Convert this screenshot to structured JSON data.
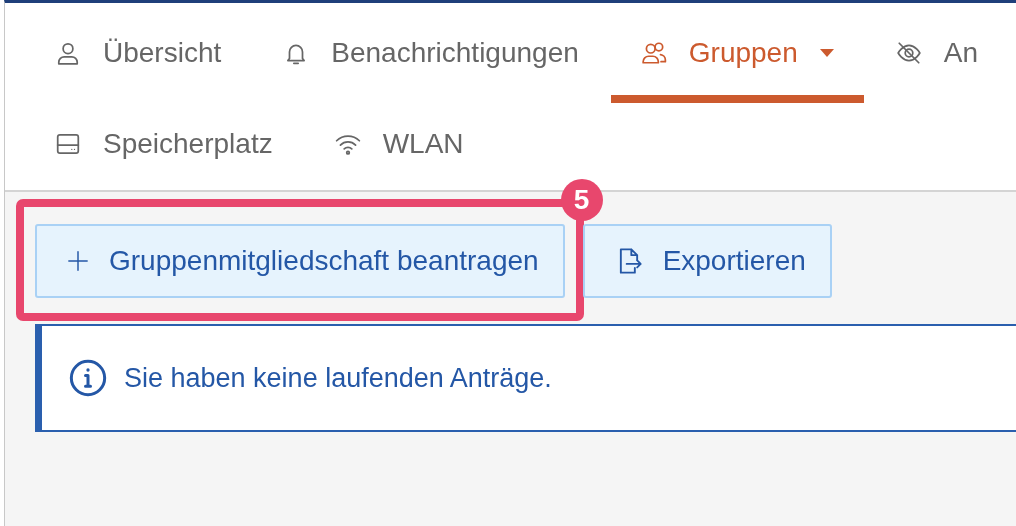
{
  "nav": {
    "rows": [
      [
        {
          "label": "Übersicht",
          "selected": false,
          "dropdown": false
        },
        {
          "label": "Benachrichtigungen",
          "selected": false,
          "dropdown": false
        },
        {
          "label": "Gruppen",
          "selected": true,
          "dropdown": true
        },
        {
          "label": "An",
          "selected": false,
          "dropdown": false
        }
      ],
      [
        {
          "label": "Speicherplatz",
          "selected": false,
          "dropdown": false
        },
        {
          "label": "WLAN",
          "selected": false,
          "dropdown": false
        }
      ]
    ]
  },
  "actions": [
    {
      "kind": "add",
      "label": "Gruppenmitgliedschaft beantragen",
      "highlighted": true,
      "badge": "5"
    },
    {
      "kind": "export",
      "label": "Exportieren",
      "highlighted": false
    }
  ],
  "notice": {
    "text": "Sie haben keine laufenden Anträge."
  }
}
